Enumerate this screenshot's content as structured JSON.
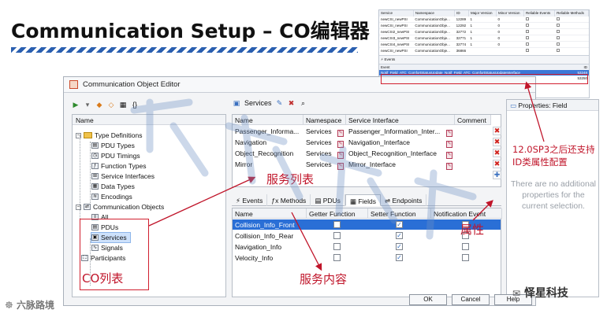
{
  "slide": {
    "title": "Communication Setup – CO编辑器"
  },
  "inset": {
    "columns": [
      "Service",
      "Namespace",
      "ID",
      "Major Version",
      "Minor Version",
      "Reliable Events",
      "Reliable Methods"
    ],
    "rows": [
      {
        "service": "newCSI_newPSI",
        "ns": "CommunicationObje...",
        "id": "12289",
        "major": "1",
        "minor": "0"
      },
      {
        "service": "newCSI_newPSI",
        "ns": "CommunicationObje...",
        "id": "12292",
        "major": "1",
        "minor": "0"
      },
      {
        "service": "newCSI2_newPSI",
        "ns": "CommunicationObje...",
        "id": "32772",
        "major": "1",
        "minor": "0"
      },
      {
        "service": "newCSI3_newPSI",
        "ns": "CommunicationObje...",
        "id": "32771",
        "major": "1",
        "minor": "0"
      },
      {
        "service": "newCSI4_newPSI",
        "ns": "CommunicationObje...",
        "id": "32774",
        "major": "1",
        "minor": "0"
      },
      {
        "service": "newCSI_newPSI",
        "ns": "CommunicationObje...",
        "id": "36866",
        "major": "",
        "minor": ""
      }
    ],
    "events_tab": "Events",
    "event_col": "Event",
    "id_col": "ID",
    "events": [
      {
        "name": "Notif_Field_ATC_ComfortStatusUpdate_Notif_Field_ATC_ComfortStatusUpdateInterface",
        "id": "53248"
      },
      {
        "name": "Notif_Field_SSCU_ComfortStatusUpdate_Notif_Field_SSCU_ComfortStatusUpdateInterface",
        "id": "53250"
      }
    ]
  },
  "window": {
    "title": "Communication Object Editor"
  },
  "tree": {
    "header": "Name",
    "type_definitions": "Type Definitions",
    "pdu_types": "PDU Types",
    "pdu_timings": "PDU Timings",
    "function_types": "Function Types",
    "service_interfaces": "Service Interfaces",
    "data_types": "Data Types",
    "encodings": "Encodings",
    "communication_objects": "Communication Objects",
    "all": "All",
    "pdus": "PDUs",
    "services": "Services",
    "signals": "Signals",
    "participants": "Participants"
  },
  "services": {
    "toolbar_label": "Services",
    "columns": {
      "name": "Name",
      "namespace": "Namespace",
      "service_interface": "Service Interface",
      "comment": "Comment"
    },
    "rows": [
      {
        "name": "Passenger_Informa...",
        "namespace": "Services",
        "iface": "Passenger_Information_Inter..."
      },
      {
        "name": "Navigation",
        "namespace": "Services",
        "iface": "Navigation_Interface"
      },
      {
        "name": "Object_Recognition",
        "namespace": "Services",
        "iface": "Object_Recognition_Interface"
      },
      {
        "name": "Mirror",
        "namespace": "Services",
        "iface": "Mirror_Interface"
      }
    ]
  },
  "tabs": {
    "events": "Events",
    "methods": "Methods",
    "pdus": "PDUs",
    "fields": "Fields",
    "endpoints": "Endpoints"
  },
  "fields": {
    "columns": {
      "name": "Name",
      "getter": "Getter Function",
      "setter": "Setter Function",
      "notification": "Notification Event"
    },
    "rows": [
      {
        "name": "Collision_Info_Front",
        "getter": false,
        "setter": true,
        "notification": false
      },
      {
        "name": "Collision_Info_Rear",
        "getter": false,
        "setter": true,
        "notification": false
      },
      {
        "name": "Navigation_Info",
        "getter": false,
        "setter": true,
        "notification": false
      },
      {
        "name": "Velocity_Info",
        "getter": false,
        "setter": true,
        "notification": false
      }
    ]
  },
  "properties": {
    "header": "Properties: Field",
    "empty_text": "There are no additional properties for the current selection."
  },
  "buttons": {
    "ok": "OK",
    "cancel": "Cancel",
    "help": "Help"
  },
  "annotations": {
    "service_list": "服务列表",
    "co_list": "CO列表",
    "service_content": "服务内容",
    "attribute": "属性",
    "id_note": "12.0SP3之后还支持ID类属性配置"
  },
  "footer": {
    "left_mark": "六脉路境",
    "right_mark": "怿星科技"
  },
  "colors": {
    "accent": "#2a6fd6",
    "annotation": "#c0152a",
    "stripe": "#2a5fb0"
  }
}
